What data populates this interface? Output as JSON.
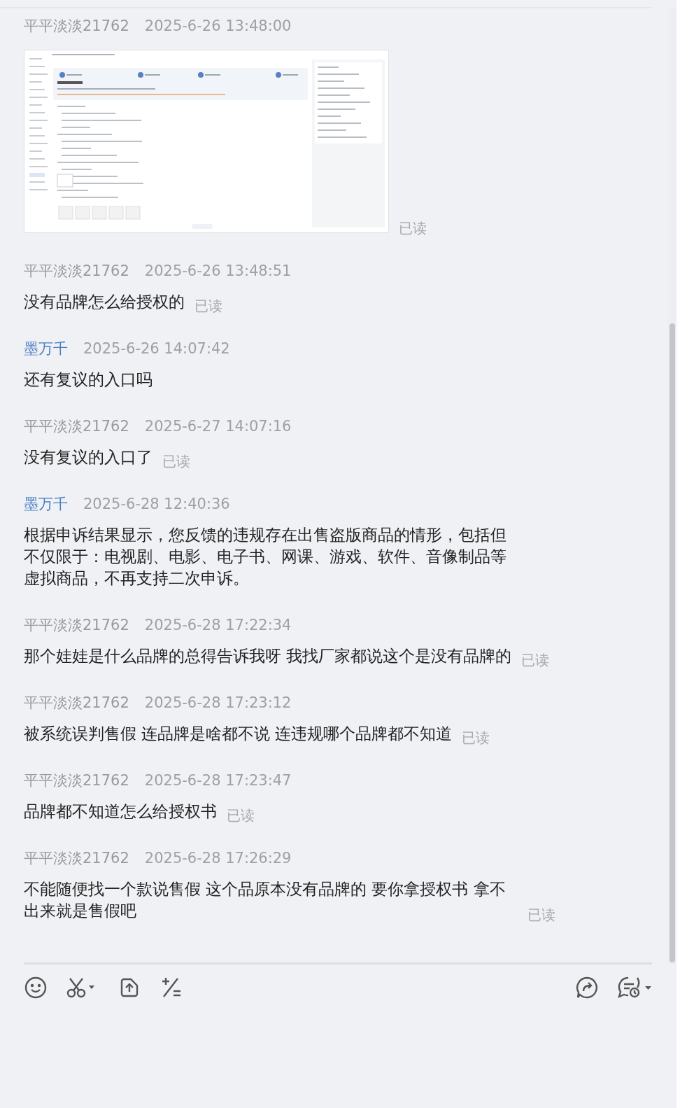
{
  "messages": [
    {
      "sender": "平平淡淡21762",
      "own": true,
      "time": "2025-6-26 13:48:00",
      "kind": "image",
      "receipt": "已读"
    },
    {
      "sender": "平平淡淡21762",
      "own": true,
      "time": "2025-6-26 13:48:51",
      "kind": "text",
      "text": "没有品牌怎么给授权的",
      "receipt": "已读"
    },
    {
      "sender": "墨万千",
      "own": false,
      "time": "2025-6-26 14:07:42",
      "kind": "text",
      "text": "还有复议的入口吗"
    },
    {
      "sender": "平平淡淡21762",
      "own": true,
      "time": "2025-6-27 14:07:16",
      "kind": "text",
      "text": "没有复议的入口了",
      "receipt": "已读"
    },
    {
      "sender": "墨万千",
      "own": false,
      "time": "2025-6-28 12:40:36",
      "kind": "text",
      "text": "根据申诉结果显示，您反馈的违规存在出售盗版商品的情形，包括但不仅限于：电视剧、电影、电子书、网课、游戏、软件、音像制品等虚拟商品，不再支持二次申诉。"
    },
    {
      "sender": "平平淡淡21762",
      "own": true,
      "time": "2025-6-28 17:22:34",
      "kind": "text",
      "text": "那个娃娃是什么品牌的总得告诉我呀 我找厂家都说这个是没有品牌的",
      "receipt": "已读"
    },
    {
      "sender": "平平淡淡21762",
      "own": true,
      "time": "2025-6-28 17:23:12",
      "kind": "text",
      "text": "被系统误判售假 连品牌是啥都不说 连违规哪个品牌都不知道",
      "receipt": "已读"
    },
    {
      "sender": "平平淡淡21762",
      "own": true,
      "time": "2025-6-28 17:23:47",
      "kind": "text",
      "text": "品牌都不知道怎么给授权书",
      "receipt": "已读"
    },
    {
      "sender": "平平淡淡21762",
      "own": true,
      "time": "2025-6-28 17:26:29",
      "kind": "text",
      "text": "不能随便找一个款说售假 这个品原本没有品牌的 要你拿授权书 拿不出来就是售假吧",
      "receipt": "已读"
    }
  ]
}
